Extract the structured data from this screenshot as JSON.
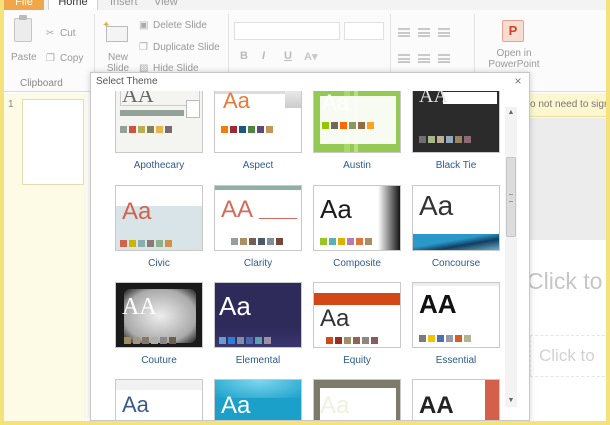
{
  "ribbon": {
    "tabs": {
      "file": "File",
      "home": "Home",
      "insert": "Insert",
      "view": "View"
    },
    "clipboard": {
      "paste": "Paste",
      "cut": "Cut",
      "copy": "Copy",
      "group_label": "Clipboard"
    },
    "slides": {
      "new_slide": "New Slide",
      "delete_slide": "Delete Slide",
      "duplicate_slide": "Duplicate Slide",
      "hide_slide": "Hide Slide"
    },
    "font": {
      "bold": "B",
      "italic": "I",
      "underline": "U"
    },
    "open_in_powerpoint": "Open in PowerPoint"
  },
  "slide_pane": {
    "slide_number": "1"
  },
  "notice": "o not need to sign",
  "canvas": {
    "title_placeholder": "Click to",
    "subtitle_placeholder": "Click to"
  },
  "dialog": {
    "title": "Select Theme",
    "close_glyph": "×",
    "themes": [
      {
        "name": "Apothecary",
        "aa": "AA",
        "bg": "#f4f4f0",
        "aa_color": "#6a6a6a",
        "swatches": [
          "#93a299",
          "#cf543f",
          "#b5ae53",
          "#848058",
          "#e8b54d",
          "#786c71"
        ]
      },
      {
        "name": "Aspect",
        "aa": "Aa",
        "bg": "#ffffff",
        "aa_color": "#e57c39",
        "swatches": [
          "#f07f09",
          "#9f2936",
          "#1b587c",
          "#4e8542",
          "#604878",
          "#c19859"
        ]
      },
      {
        "name": "Austin",
        "aa": "Aa",
        "bg": "#94c954",
        "aa_color": "#ffffff",
        "swatches": [
          "#94c600",
          "#71685a",
          "#ff6700",
          "#909465",
          "#956b43",
          "#fea022"
        ]
      },
      {
        "name": "Black Tie",
        "aa": "AA",
        "bg": "#2b2b2b",
        "aa_color": "#e6e6e6",
        "swatches": [
          "#6f6f74",
          "#a7b789",
          "#beae98",
          "#92a9b9",
          "#9c8265",
          "#8d6974"
        ]
      },
      {
        "name": "Civic",
        "aa": "Aa",
        "bg": "#ffffff",
        "aa_color": "#d16349",
        "swatches": [
          "#d16349",
          "#ccb400",
          "#8cadae",
          "#8c7b70",
          "#8fb08c",
          "#d19049"
        ]
      },
      {
        "name": "Clarity",
        "aa": "AA",
        "bg": "#ffffff",
        "aa_color": "#d46a5a",
        "swatches": [
          "#93a299",
          "#ad8f67",
          "#726056",
          "#4c5a6a",
          "#808da0",
          "#79463d"
        ]
      },
      {
        "name": "Composite",
        "aa": "Aa",
        "bg": "#ffffff",
        "aa_color": "#1a1a1a",
        "swatches": [
          "#98c723",
          "#59b0b9",
          "#deae00",
          "#b77bb4",
          "#e0773c",
          "#a98d63"
        ]
      },
      {
        "name": "Concourse",
        "aa": "Aa",
        "bg": "#ffffff",
        "aa_color": "#333333",
        "swatches": []
      },
      {
        "name": "Couture",
        "aa": "AA",
        "bg": "#1a1a1a",
        "aa_color": "#ffffff",
        "swatches": [
          "#9e8e5c",
          "#a09781",
          "#85776d",
          "#aeafa9",
          "#8d878b",
          "#6b6149"
        ]
      },
      {
        "name": "Elemental",
        "aa": "Aa",
        "bg": "#2e2a5a",
        "aa_color": "#ffffff",
        "swatches": [
          "#629dd1",
          "#297fd5",
          "#7f8fa9",
          "#4a66ac",
          "#5aa2ae",
          "#9d90a0"
        ]
      },
      {
        "name": "Equity",
        "aa": "Aa",
        "bg": "#ffffff",
        "aa_color": "#333333",
        "swatches": [
          "#d34817",
          "#9b2d1f",
          "#a28e6a",
          "#956251",
          "#918485",
          "#855d5d"
        ]
      },
      {
        "name": "Essential",
        "aa": "AA",
        "bg": "#ffffff",
        "aa_color": "#111111",
        "swatches": [
          "#7a7a7a",
          "#f5c201",
          "#526db0",
          "#989aac",
          "#dc5924",
          "#b4b392"
        ]
      },
      {
        "name": "",
        "aa": "Aa",
        "bg": "#ffffff",
        "aa_color": "#3a5a8a",
        "swatches": []
      },
      {
        "name": "",
        "aa": "Aa",
        "bg": "#1aa0c9",
        "aa_color": "#ffffff",
        "swatches": []
      },
      {
        "name": "",
        "aa": "Aa",
        "bg": "#7d7a6a",
        "aa_color": "#f0f0e0",
        "swatches": []
      },
      {
        "name": "",
        "aa": "AA",
        "bg": "#ffffff",
        "aa_color": "#222222",
        "swatches": []
      }
    ]
  }
}
